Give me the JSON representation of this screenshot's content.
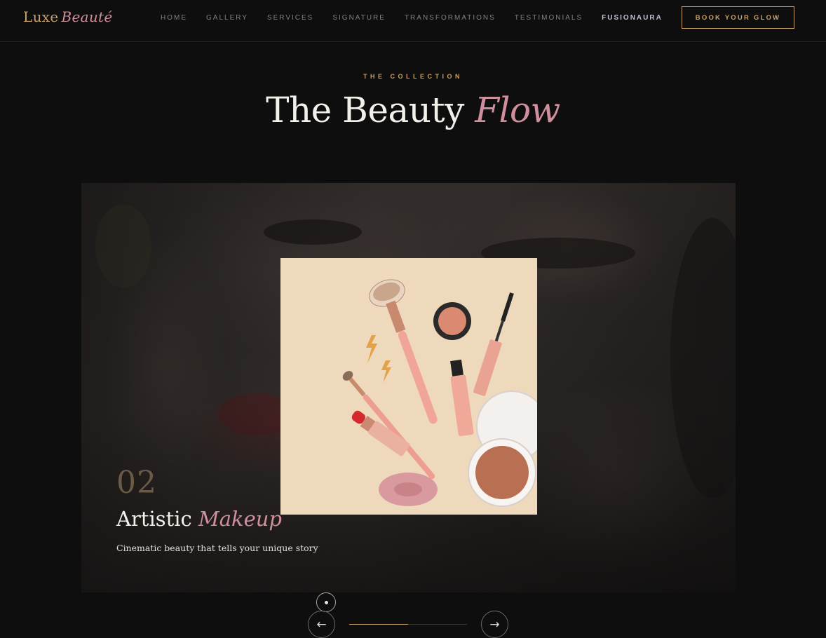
{
  "brand": {
    "name": "Luxe",
    "accent": "Beauté"
  },
  "nav": {
    "items": [
      "HOME",
      "GALLERY",
      "SERVICES",
      "SIGNATURE",
      "TRANSFORMATIONS",
      "TESTIMONIALS",
      "FUSIONAURA"
    ],
    "active_item": "FUSIONAURA",
    "cta_label": "BOOK YOUR GLOW"
  },
  "section": {
    "eyebrow": "THE COLLECTION",
    "title_main": "The Beauty",
    "title_accent": "Flow"
  },
  "slide": {
    "number": "02",
    "title_main": "Artistic",
    "title_accent": "Makeup",
    "subtitle": "Cinematic beauty that tells your unique story",
    "progress": 0.5
  },
  "controls": {
    "prev_icon": "arrow-left-icon",
    "next_icon": "arrow-right-icon",
    "prev_glyph": "←",
    "next_glyph": "→"
  },
  "colors": {
    "background": "#0f0e0e",
    "gold": "#c9a067",
    "rose": "#cf8f9c",
    "card_bg": "#efd9bd"
  }
}
